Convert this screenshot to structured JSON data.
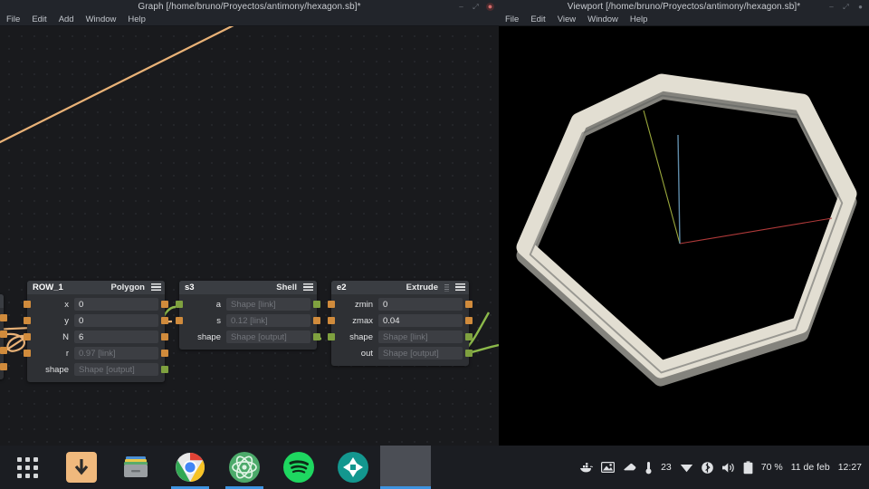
{
  "graph_window": {
    "title": "Graph [/home/bruno/Proyectos/antimony/hexagon.sb]*",
    "menu": [
      "File",
      "Edit",
      "Add",
      "Window",
      "Help"
    ],
    "controls": {
      "minimize": "–",
      "maximize": "⤢",
      "close": "●"
    },
    "nodes": [
      {
        "name": "ROW_1",
        "type": "Polygon",
        "rows": [
          {
            "label": "x",
            "value": "0",
            "ghost": false,
            "in_port": "orange",
            "out_port": "orange"
          },
          {
            "label": "y",
            "value": "0",
            "ghost": false,
            "in_port": "orange",
            "out_port": "orange"
          },
          {
            "label": "N",
            "value": "6",
            "ghost": false,
            "in_port": "orange",
            "out_port": "orange"
          },
          {
            "label": "r",
            "value": "0.97 [link]",
            "ghost": true,
            "in_port": "orange",
            "out_port": "orange"
          },
          {
            "label": "shape",
            "value": "Shape [output]",
            "ghost": true,
            "in_port": "none",
            "out_port": "green"
          }
        ]
      },
      {
        "name": "s3",
        "type": "Shell",
        "rows": [
          {
            "label": "a",
            "value": "Shape [link]",
            "ghost": true,
            "in_port": "green",
            "out_port": "green"
          },
          {
            "label": "s",
            "value": "0.12 [link]",
            "ghost": true,
            "in_port": "orange",
            "out_port": "orange"
          },
          {
            "label": "shape",
            "value": "Shape [output]",
            "ghost": true,
            "in_port": "none",
            "out_port": "green"
          }
        ]
      },
      {
        "name": "e2",
        "type": "Extrude",
        "rows": [
          {
            "label": "zmin",
            "value": "0",
            "ghost": false,
            "in_port": "orange",
            "out_port": "orange"
          },
          {
            "label": "zmax",
            "value": "0.04",
            "ghost": false,
            "in_port": "orange",
            "out_port": "orange"
          },
          {
            "label": "shape",
            "value": "Shape [link]",
            "ghost": true,
            "in_port": "green",
            "out_port": "green"
          },
          {
            "label": "out",
            "value": "Shape [output]",
            "ghost": true,
            "in_port": "none",
            "out_port": "green"
          }
        ]
      }
    ],
    "wire_colors": {
      "scalar": "#e9b277",
      "shape": "#8cb94a"
    }
  },
  "viewport_window": {
    "title": "Viewport [/home/bruno/Proyectos/antimony/hexagon.sb]*",
    "menu": [
      "File",
      "Edit",
      "View",
      "Window",
      "Help"
    ],
    "controls": {
      "minimize": "–",
      "maximize": "⤢",
      "close": "●"
    },
    "scene": {
      "object": "hexagonal shell",
      "object_color": "#e2ded2",
      "background": "#000000",
      "axes": {
        "x": "#b03a3a",
        "y": "#9aa83c",
        "z": "#5f8ba8"
      }
    }
  },
  "taskbar": {
    "apps": [
      {
        "name": "show-applications",
        "icon": "grid-icon",
        "running": false
      },
      {
        "name": "downloads",
        "icon": "download-icon",
        "running": false
      },
      {
        "name": "files",
        "icon": "file-manager-icon",
        "running": false
      },
      {
        "name": "google-chrome",
        "icon": "chrome-icon",
        "running": true
      },
      {
        "name": "atom",
        "icon": "atom-icon",
        "running": true
      },
      {
        "name": "spotify",
        "icon": "spotify-icon",
        "running": false
      },
      {
        "name": "shotwell",
        "icon": "aperture-icon",
        "running": false
      }
    ],
    "tray": {
      "icons": [
        "docker-icon",
        "screenshot-icon",
        "eraser-icon",
        "thermometer-icon",
        "wifi-icon",
        "bluetooth-icon",
        "volume-icon",
        "battery-icon"
      ],
      "temperature": "23",
      "battery": "70 %",
      "date": "11 de feb",
      "time": "12:27"
    }
  }
}
